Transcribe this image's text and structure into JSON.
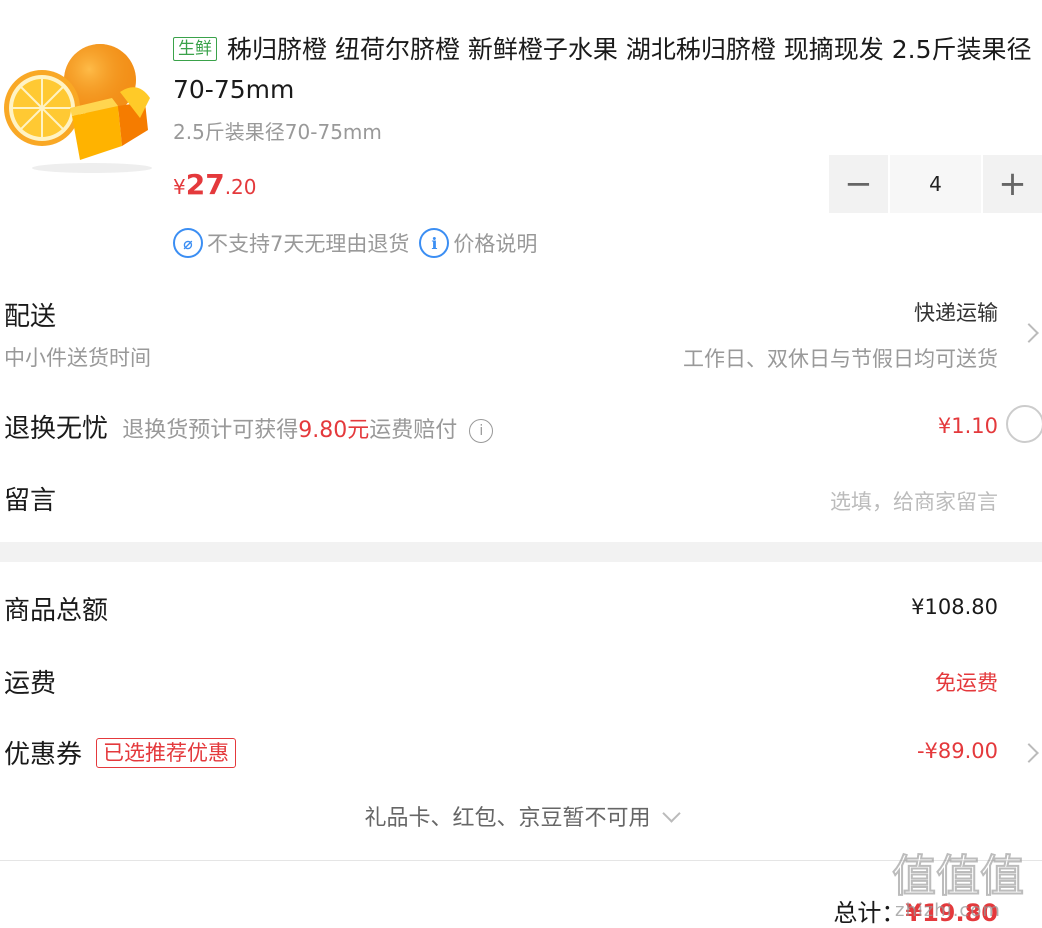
{
  "product": {
    "image_icon": "orange-fruit-image",
    "tag": "生鲜",
    "title": "秭归脐橙 纽荷尔脐橙 新鲜橙子水果 湖北秭归脐橙 现摘现发 2.5斤装果径70-75mm",
    "spec": "2.5斤装果径70-75mm",
    "price": {
      "symbol": "¥",
      "integer": "27",
      "decimal": ".20"
    },
    "quantity": "4",
    "minus_label": "−",
    "plus_label": "+",
    "notes": [
      {
        "icon": "no-return-icon",
        "glyph": "⌀",
        "text": "不支持7天无理由退货"
      },
      {
        "icon": "info-icon",
        "glyph": "i",
        "text": "价格说明"
      }
    ]
  },
  "delivery": {
    "label": "配送",
    "sublabel": "中小件送货时间",
    "method": "快递运输",
    "schedule": "工作日、双休日与节假日均可送货"
  },
  "return_worry_free": {
    "label": "退换无忧",
    "desc_prefix": "退换货预计可获得",
    "desc_amount": "9.80元",
    "desc_suffix": "运费赔付",
    "price": "¥1.10"
  },
  "message": {
    "label": "留言",
    "placeholder": "选填，给商家留言"
  },
  "summary": {
    "goods_total_label": "商品总额",
    "goods_total_value": "¥108.80",
    "shipping_label": "运费",
    "shipping_value": "免运费",
    "coupon_label": "优惠券",
    "coupon_tag": "已选推荐优惠",
    "coupon_value": "-¥89.00",
    "more_options": "礼品卡、红包、京豆暂不可用",
    "total_label": "总计：",
    "total_value": "¥19.80"
  },
  "watermark": {
    "text": "zhizhi.com",
    "glyphs": "值值值"
  },
  "colors": {
    "accent_red": "#e4393c",
    "fresh_green": "#3aa24a",
    "info_blue": "#3b8ef3"
  }
}
